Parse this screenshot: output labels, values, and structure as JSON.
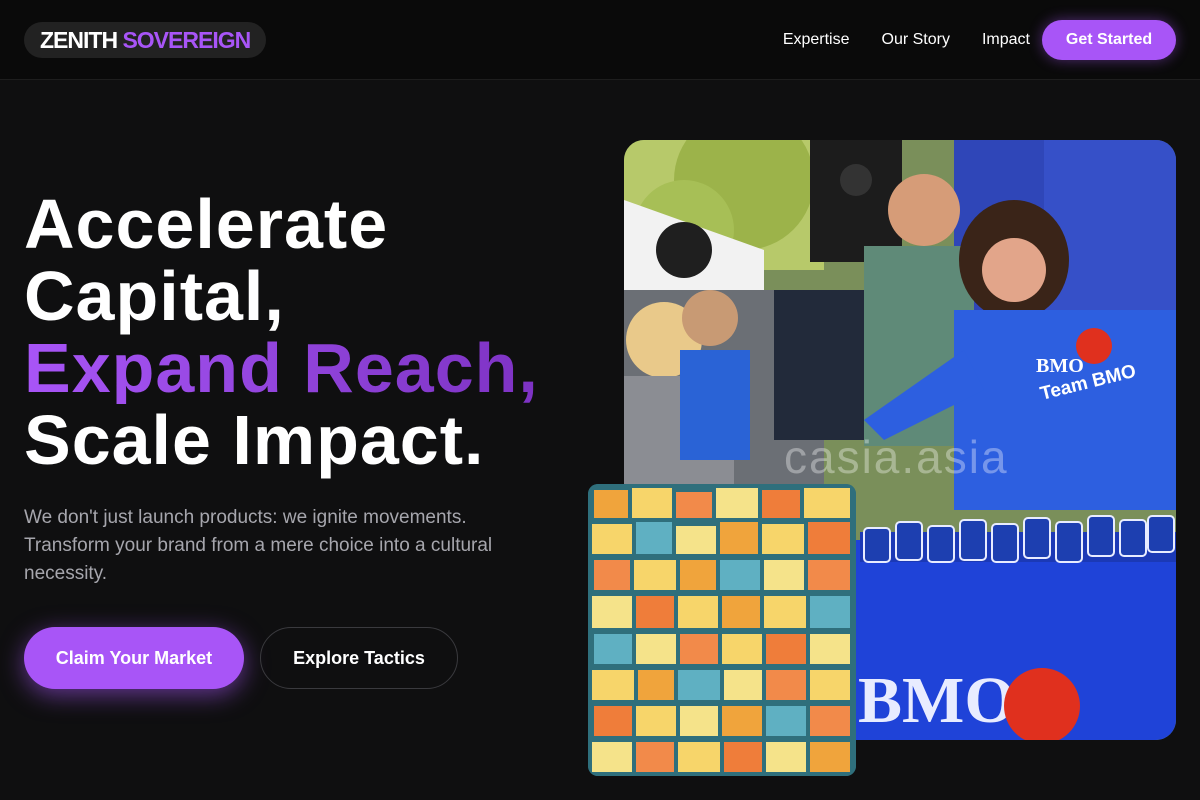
{
  "header": {
    "logo": {
      "word1": "ZENITH",
      "word2": "SOVEREIGN"
    },
    "nav": [
      "Expertise",
      "Our Story",
      "Impact"
    ],
    "cta_label": "Get Started"
  },
  "hero": {
    "headline": {
      "line1": "Accelerate",
      "line2": "Capital,",
      "line3": "Expand Reach,",
      "line4": "Scale Impact."
    },
    "subtext": "We don't just launch products: we ignite movements. Transform your brand from a mere choice into a cultural necessity.",
    "primary_button": "Claim Your Market",
    "secondary_button": "Explore Tactics"
  },
  "images": {
    "main_photo_shirt_text": "Team BMO",
    "main_photo_brand": "BMO",
    "main_photo_watermark": "casia.asia"
  },
  "colors": {
    "background": "#0f0f10",
    "accent": "#a855f7",
    "muted_text": "#a6a6ad"
  }
}
